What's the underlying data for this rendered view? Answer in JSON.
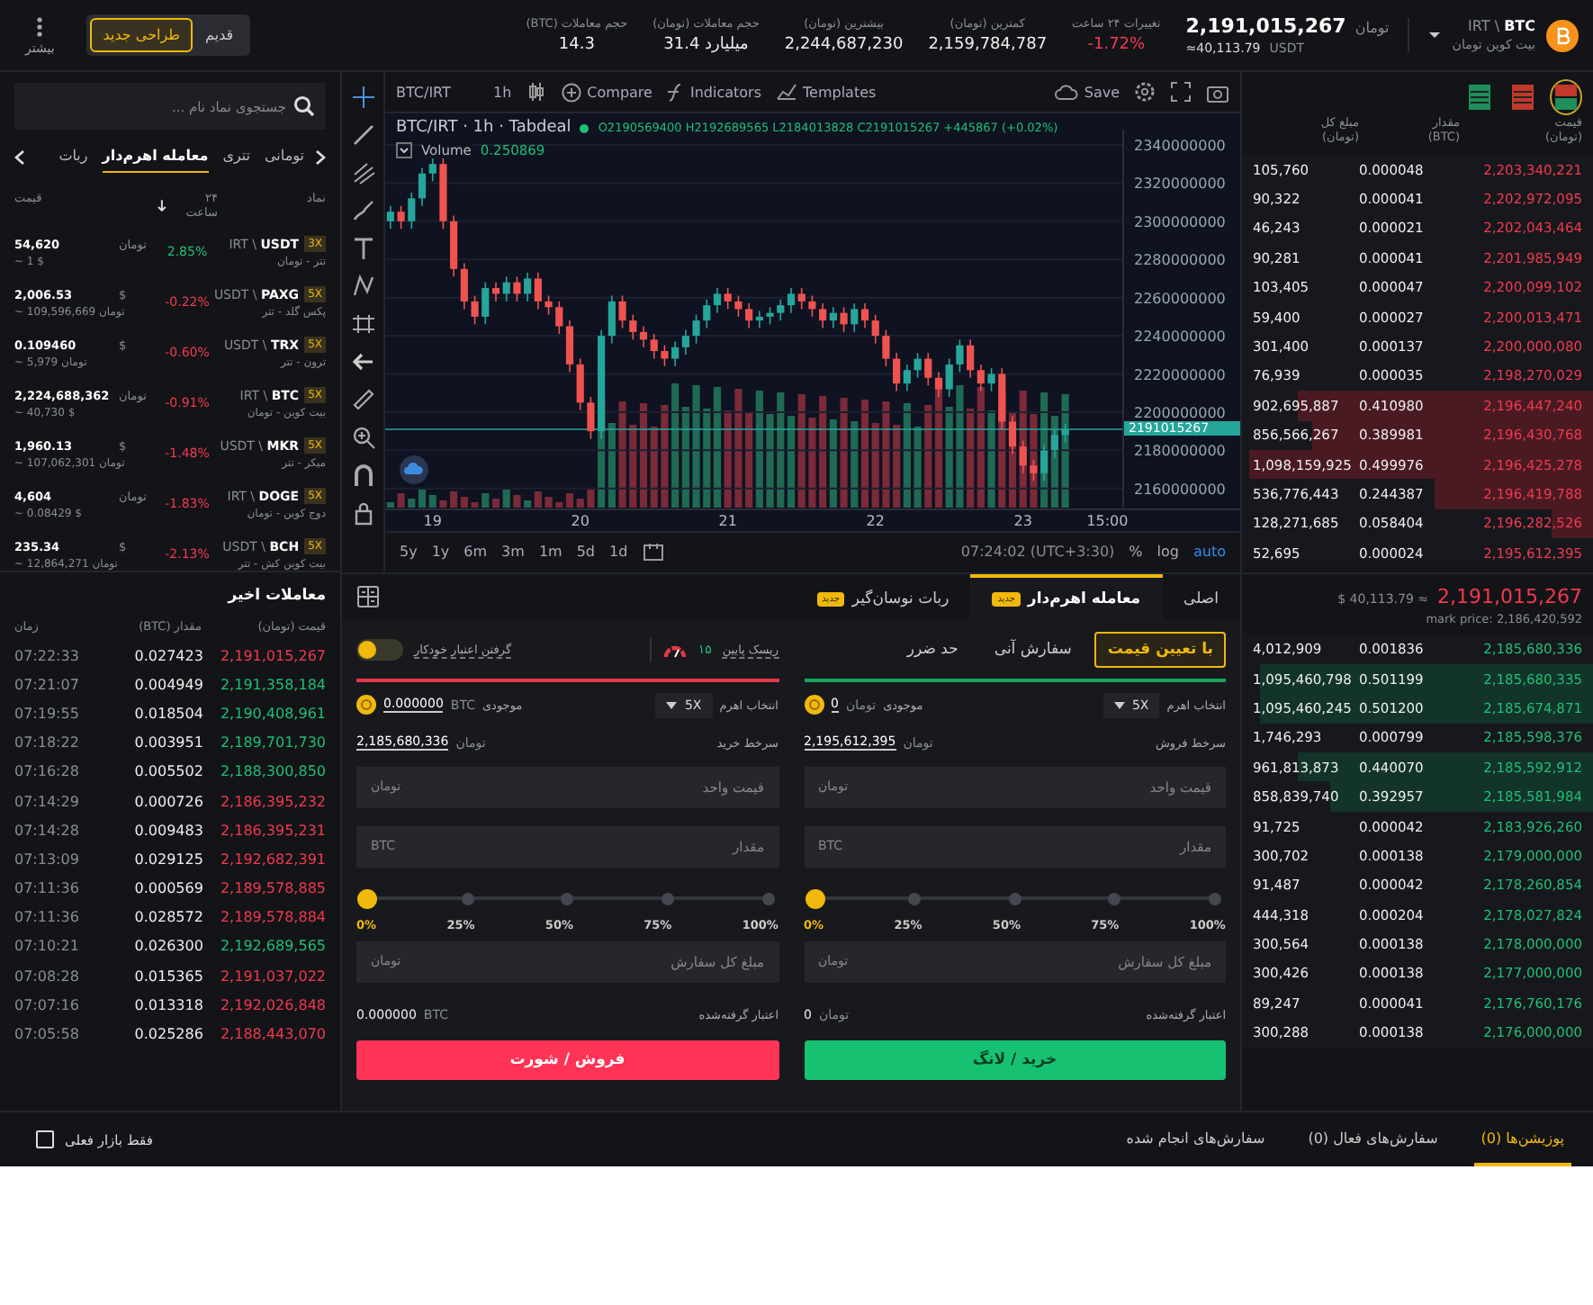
{
  "top_bar": {
    "more": {
      "label": "بیشتر"
    },
    "design_toggle": [
      {
        "label": "قدیم",
        "selected": false
      },
      {
        "label": "طراحی جدید",
        "selected": true
      }
    ],
    "stats": {
      "change_24h": {
        "label": "تغییرات ۲۴ ساعت",
        "value": "-1.72%",
        "falling": true
      },
      "low": {
        "label": "کمترین (تومان)",
        "value": "2,159,784,787",
        "falling": false
      },
      "high": {
        "label": "بیشترین (تومان)",
        "value": "2,244,687,230",
        "falling": false
      },
      "volume_toman": {
        "label": "حجم معاملات (تومان)",
        "value": "31.4 میلیارد",
        "falling": false
      },
      "volume_btc": {
        "label": "حجم معاملات (BTC)",
        "value": "14.3",
        "falling": false
      }
    },
    "price": {
      "value": "2,191,015,267",
      "unit": "تومان",
      "approx": "≈40,113.79",
      "approx_unit": "USDT"
    },
    "market": {
      "symbol": "BTC",
      "quote": "IRT \\",
      "name": "بیت کوین تومان"
    }
  },
  "markets": {
    "search": {
      "placeholder": "جستجوی نماد نام ..."
    },
    "tabs": [
      {
        "label": "تومانی",
        "selected": false
      },
      {
        "label": "تتری",
        "selected": false
      },
      {
        "label": "معامله اهرم‌دار",
        "selected": true
      },
      {
        "label": "ربات",
        "selected": false
      }
    ],
    "columns": [
      "نماد",
      "۲۴ ساعت",
      "قیمت"
    ],
    "rows": [
      {
        "symbol": "USDT",
        "quote": "IRT \\",
        "leverage": "3X",
        "name": "تتر - تومان",
        "change": "2.85%",
        "falling": false,
        "price": "54,620",
        "price_unit": "تومان",
        "approx": "~ 1 $"
      },
      {
        "symbol": "PAXG",
        "quote": "USDT \\",
        "leverage": "5X",
        "name": "پکس گلد - تتر",
        "change": "-0.22%",
        "falling": true,
        "price": "2,006.53",
        "price_unit": "$",
        "approx": "~ 109,596,669 تومان"
      },
      {
        "symbol": "TRX",
        "quote": "USDT \\",
        "leverage": "5X",
        "name": "ترون - تتر",
        "change": "-0.60%",
        "falling": true,
        "price": "0.109460",
        "price_unit": "$",
        "approx": "~ 5,979 تومان"
      },
      {
        "symbol": "BTC",
        "quote": "IRT \\",
        "leverage": "5X",
        "name": "بیت کوین - تومان",
        "change": "-0.91%",
        "falling": true,
        "price": "2,224,688,362",
        "price_unit": "تومان",
        "approx": "~ 40,730 $"
      },
      {
        "symbol": "MKR",
        "quote": "USDT \\",
        "leverage": "5X",
        "name": "میکر - تتر",
        "change": "-1.48%",
        "falling": true,
        "price": "1,960.13",
        "price_unit": "$",
        "approx": "~ 107,062,301 تومان"
      },
      {
        "symbol": "DOGE",
        "quote": "IRT \\",
        "leverage": "5X",
        "name": "دوج کوین - تومان",
        "change": "-1.83%",
        "falling": true,
        "price": "4,604",
        "price_unit": "تومان",
        "approx": "~ 0.08429 $"
      },
      {
        "symbol": "BCH",
        "quote": "USDT \\",
        "leverage": "5X",
        "name": "بیت کوین کش - تتر",
        "change": "-2.13%",
        "falling": true,
        "price": "235.34",
        "price_unit": "$",
        "approx": "~ 12,864,271 تومان"
      }
    ]
  },
  "chart": {
    "toolbar": {
      "symbol": "BTC/IRT",
      "interval": "1h",
      "compare": "Compare",
      "indicators": "Indicators",
      "templates": "Templates",
      "save": "Save"
    },
    "legend": {
      "title": "BTC/IRT · 1h · Tabdeal",
      "ohlc": "O2190569400 H2192689565 L2184013828 C2191015267 +445867 (+0.02%)",
      "volume_label": "Volume",
      "volume_value": "0.250869"
    },
    "chart_data": {
      "type": "candlestick",
      "categories": [
        null,
        null,
        null,
        null,
        "19",
        null,
        null,
        null,
        null,
        null,
        null,
        null,
        null,
        null,
        null,
        null,
        null,
        null,
        "20",
        null,
        null,
        null,
        null,
        null,
        null,
        null,
        null,
        null,
        null,
        null,
        null,
        null,
        "21",
        null,
        null,
        null,
        null,
        null,
        null,
        null,
        null,
        null,
        null,
        null,
        null,
        null,
        "22",
        null,
        null,
        null,
        null,
        null,
        null,
        null,
        null,
        null,
        null,
        null,
        null,
        null,
        "23",
        null,
        null,
        null,
        null,
        null,
        null,
        null,
        "15:00",
        null
      ],
      "ohlc": [
        [
          2300000000,
          2308000000,
          2296000000,
          2305000000
        ],
        [
          2305000000,
          2308000000,
          2296000000,
          2300000000
        ],
        [
          2300000000,
          2315000000,
          2296000000,
          2312000000
        ],
        [
          2312000000,
          2328000000,
          2308000000,
          2325000000
        ],
        [
          2325000000,
          2333000000,
          2321000000,
          2330000000
        ],
        [
          2330000000,
          2333000000,
          2296000000,
          2300000000
        ],
        [
          2300000000,
          2303000000,
          2271000000,
          2275000000
        ],
        [
          2275000000,
          2278000000,
          2254000000,
          2258000000
        ],
        [
          2258000000,
          2261000000,
          2246000000,
          2250000000
        ],
        [
          2250000000,
          2268000000,
          2246000000,
          2265000000
        ],
        [
          2265000000,
          2268000000,
          2258000000,
          2262000000
        ],
        [
          2262000000,
          2271000000,
          2258000000,
          2268000000
        ],
        [
          2268000000,
          2271000000,
          2258000000,
          2262000000
        ],
        [
          2262000000,
          2273000000,
          2258000000,
          2270000000
        ],
        [
          2270000000,
          2273000000,
          2254000000,
          2258000000
        ],
        [
          2258000000,
          2261000000,
          2251000000,
          2255000000
        ],
        [
          2255000000,
          2258000000,
          2241000000,
          2245000000
        ],
        [
          2245000000,
          2248000000,
          2221000000,
          2225000000
        ],
        [
          2225000000,
          2228000000,
          2201000000,
          2205000000
        ],
        [
          2205000000,
          2208000000,
          2186000000,
          2190000000
        ],
        [
          2190000000,
          2243000000,
          2186000000,
          2240000000
        ],
        [
          2240000000,
          2261000000,
          2236000000,
          2258000000
        ],
        [
          2258000000,
          2261000000,
          2244000000,
          2248000000
        ],
        [
          2248000000,
          2251000000,
          2238000000,
          2242000000
        ],
        [
          2242000000,
          2245000000,
          2234000000,
          2238000000
        ],
        [
          2238000000,
          2241000000,
          2228000000,
          2232000000
        ],
        [
          2232000000,
          2235000000,
          2224000000,
          2228000000
        ],
        [
          2228000000,
          2237000000,
          2224000000,
          2234000000
        ],
        [
          2234000000,
          2243000000,
          2230000000,
          2240000000
        ],
        [
          2240000000,
          2251000000,
          2236000000,
          2248000000
        ],
        [
          2248000000,
          2259000000,
          2244000000,
          2256000000
        ],
        [
          2256000000,
          2265000000,
          2252000000,
          2262000000
        ],
        [
          2262000000,
          2265000000,
          2254000000,
          2258000000
        ],
        [
          2258000000,
          2261000000,
          2250000000,
          2254000000
        ],
        [
          2254000000,
          2257000000,
          2244000000,
          2248000000
        ],
        [
          2248000000,
          2253000000,
          2244000000,
          2250000000
        ],
        [
          2250000000,
          2255000000,
          2246000000,
          2252000000
        ],
        [
          2252000000,
          2259000000,
          2248000000,
          2256000000
        ],
        [
          2256000000,
          2265000000,
          2252000000,
          2262000000
        ],
        [
          2262000000,
          2265000000,
          2254000000,
          2258000000
        ],
        [
          2258000000,
          2261000000,
          2250000000,
          2254000000
        ],
        [
          2254000000,
          2257000000,
          2244000000,
          2248000000
        ],
        [
          2248000000,
          2255000000,
          2244000000,
          2252000000
        ],
        [
          2252000000,
          2255000000,
          2242000000,
          2246000000
        ],
        [
          2246000000,
          2257000000,
          2242000000,
          2254000000
        ],
        [
          2254000000,
          2257000000,
          2244000000,
          2248000000
        ],
        [
          2248000000,
          2251000000,
          2236000000,
          2240000000
        ],
        [
          2240000000,
          2243000000,
          2224000000,
          2228000000
        ],
        [
          2228000000,
          2231000000,
          2211000000,
          2215000000
        ],
        [
          2215000000,
          2225000000,
          2211000000,
          2222000000
        ],
        [
          2222000000,
          2231000000,
          2218000000,
          2228000000
        ],
        [
          2228000000,
          2231000000,
          2214000000,
          2218000000
        ],
        [
          2218000000,
          2221000000,
          2208000000,
          2212000000
        ],
        [
          2212000000,
          2228000000,
          2208000000,
          2225000000
        ],
        [
          2225000000,
          2238000000,
          2221000000,
          2235000000
        ],
        [
          2235000000,
          2238000000,
          2218000000,
          2222000000
        ],
        [
          2222000000,
          2225000000,
          2211000000,
          2215000000
        ],
        [
          2215000000,
          2223000000,
          2211000000,
          2220000000
        ],
        [
          2220000000,
          2223000000,
          2191000000,
          2195000000
        ],
        [
          2195000000,
          2198000000,
          2178000000,
          2182000000
        ],
        [
          2182000000,
          2185000000,
          2168000000,
          2172000000
        ],
        [
          2172000000,
          2175000000,
          2164000000,
          2168000000
        ],
        [
          2168000000,
          2183000000,
          2164000000,
          2180000000
        ],
        [
          2180000000,
          2191000000,
          2176000000,
          2188000000
        ],
        [
          2188000000,
          2194000000,
          2184000000,
          2191015267
        ],
        null,
        null,
        null,
        null,
        null
      ],
      "ylim": [
        2150000000,
        2348000000
      ],
      "grid": true,
      "yticks": [
        2340000000,
        2320000000,
        2300000000,
        2280000000,
        2260000000,
        2240000000,
        2220000000,
        2200000000,
        2180000000,
        2160000000
      ]
    },
    "price_tag": "2191015267",
    "ranges": [
      "5y",
      "1y",
      "6m",
      "3m",
      "1m",
      "5d",
      "1d"
    ],
    "time": "07:24:02 (UTC+3:30)",
    "scale": [
      "%",
      "log",
      "auto"
    ]
  },
  "trade_form": {
    "tabs": [
      {
        "label": "اصلی",
        "selected": false
      },
      {
        "label": "معامله اهرم‌دار",
        "selected": true,
        "badge": "جدید"
      },
      {
        "label": "ربات نوسان‌گیر",
        "selected": false,
        "badge": "جدید"
      }
    ],
    "order_types": [
      {
        "label": "با تعیین قیمت",
        "selected": true
      },
      {
        "label": "سفارش آنی",
        "selected": false
      },
      {
        "label": "حد ضرر",
        "selected": false
      }
    ],
    "risk": {
      "label": "ریسک پایین",
      "value": "۱۵"
    },
    "auto_credit": {
      "label": "گرفتن اعتبار خودکار",
      "on": false
    },
    "sides": {
      "buy": {
        "kind": "buy",
        "leverage_label": "انتخاب اهرم",
        "leverage": "5X",
        "balance_label": "موجودی",
        "balance": "0",
        "balance_unit": "تومان",
        "best_label": "سرخط فروش",
        "best": "2,195,612,395",
        "best_unit": "تومان",
        "fields": [
          {
            "placeholder": "قیمت واحد",
            "unit": "تومان"
          },
          {
            "placeholder": "مقدار",
            "unit": "BTC"
          }
        ],
        "level": 0,
        "marks": [
          "0%",
          "25%",
          "50%",
          "75%",
          "100%"
        ],
        "total": {
          "placeholder": "مبلغ کل سفارش",
          "unit": "تومان"
        },
        "credit_label": "اعتبار گرفته‌شده",
        "credit": "0",
        "credit_unit": "تومان",
        "button": "خرید / لانگ"
      },
      "sell": {
        "kind": "sell",
        "leverage_label": "انتخاب اهرم",
        "leverage": "5X",
        "balance_label": "موجودی",
        "balance": "0.000000",
        "balance_unit": "BTC",
        "best_label": "سرخط خرید",
        "best": "2,185,680,336",
        "best_unit": "تومان",
        "fields": [
          {
            "placeholder": "قیمت واحد",
            "unit": "تومان"
          },
          {
            "placeholder": "مقدار",
            "unit": "BTC"
          }
        ],
        "level": 0,
        "marks": [
          "0%",
          "25%",
          "50%",
          "75%",
          "100%"
        ],
        "total": {
          "placeholder": "مبلغ کل سفارش",
          "unit": "تومان"
        },
        "credit_label": "اعتبار گرفته‌شده",
        "credit": "0.000000",
        "credit_unit": "BTC",
        "button": "فروش / شورت"
      }
    }
  },
  "recent_trades": {
    "title": "معاملات اخیر",
    "columns": [
      "قیمت (تومان)",
      "مقدار (BTC)",
      "زمان"
    ],
    "rows": [
      {
        "price": "2,191,015,267",
        "amount": "0.027423",
        "time": "07:22:33",
        "kind": "sell"
      },
      {
        "price": "2,191,358,184",
        "amount": "0.004949",
        "time": "07:21:07",
        "kind": "buy"
      },
      {
        "price": "2,190,408,961",
        "amount": "0.018504",
        "time": "07:19:55",
        "kind": "buy"
      },
      {
        "price": "2,189,701,730",
        "amount": "0.003951",
        "time": "07:18:22",
        "kind": "buy"
      },
      {
        "price": "2,188,300,850",
        "amount": "0.005502",
        "time": "07:16:28",
        "kind": "buy"
      },
      {
        "price": "2,186,395,232",
        "amount": "0.000726",
        "time": "07:14:29",
        "kind": "sell"
      },
      {
        "price": "2,186,395,231",
        "amount": "0.009483",
        "time": "07:14:28",
        "kind": "sell"
      },
      {
        "price": "2,192,682,391",
        "amount": "0.029125",
        "time": "07:13:09",
        "kind": "sell"
      },
      {
        "price": "2,189,578,885",
        "amount": "0.000569",
        "time": "07:11:36",
        "kind": "sell"
      },
      {
        "price": "2,189,578,884",
        "amount": "0.028572",
        "time": "07:11:36",
        "kind": "sell"
      },
      {
        "price": "2,192,689,565",
        "amount": "0.026300",
        "time": "07:10:21",
        "kind": "buy"
      },
      {
        "price": "2,191,037,022",
        "amount": "0.015365",
        "time": "07:08:28",
        "kind": "sell"
      },
      {
        "price": "2,192,026,848",
        "amount": "0.013318",
        "time": "07:07:16",
        "kind": "sell"
      },
      {
        "price": "2,188,443,070",
        "amount": "0.025286",
        "time": "07:05:58",
        "kind": "sell"
      }
    ]
  },
  "order_book": {
    "views": [
      {
        "kind": "both",
        "selected": true
      },
      {
        "kind": "asks",
        "selected": false
      },
      {
        "kind": "bids",
        "selected": false
      }
    ],
    "columns": [
      {
        "label": "قیمت",
        "unit": "(تومان)"
      },
      {
        "label": "مقدار",
        "unit": "(BTC)"
      },
      {
        "label": "مبلغ کل",
        "unit": "(تومان)"
      }
    ],
    "asks": [
      {
        "price": "2,203,340,221",
        "amount": "0.000048",
        "total": "105,760"
      },
      {
        "price": "2,202,972,095",
        "amount": "0.000041",
        "total": "90,322"
      },
      {
        "price": "2,202,043,464",
        "amount": "0.000021",
        "total": "46,243"
      },
      {
        "price": "2,201,985,949",
        "amount": "0.000041",
        "total": "90,281"
      },
      {
        "price": "2,200,099,102",
        "amount": "0.000047",
        "total": "103,405"
      },
      {
        "price": "2,200,013,471",
        "amount": "0.000027",
        "total": "59,400"
      },
      {
        "price": "2,200,000,080",
        "amount": "0.000137",
        "total": "301,400"
      },
      {
        "price": "2,198,270,029",
        "amount": "0.000035",
        "total": "76,939"
      },
      {
        "price": "2,196,447,240",
        "amount": "0.410980",
        "total": "902,695,887",
        "level": 0.84
      },
      {
        "price": "2,196,430,768",
        "amount": "0.389981",
        "total": "856,566,267",
        "level": 0.8
      },
      {
        "price": "2,196,425,278",
        "amount": "0.499976",
        "total": "1,098,159,925",
        "level": 0.98
      },
      {
        "price": "2,196,419,788",
        "amount": "0.244387",
        "total": "536,776,443",
        "level": 0.45
      },
      {
        "price": "2,196,282,526",
        "amount": "0.058404",
        "total": "128,271,685",
        "level": 0.12
      },
      {
        "price": "2,195,612,395",
        "amount": "0.000024",
        "total": "52,695"
      }
    ],
    "last_price": "2,191,015,267",
    "last_approx": "$ 40,113.79 ≈",
    "mark_price": "mark price: 2,186,420,592",
    "bids": [
      {
        "price": "2,185,680,336",
        "amount": "0.001836",
        "total": "4,012,909"
      },
      {
        "price": "2,185,680,335",
        "amount": "0.501199",
        "total": "1,095,460,798",
        "level": 0.95
      },
      {
        "price": "2,185,674,871",
        "amount": "0.501200",
        "total": "1,095,460,245",
        "level": 0.95
      },
      {
        "price": "2,185,598,376",
        "amount": "0.000799",
        "total": "1,746,293"
      },
      {
        "price": "2,185,592,912",
        "amount": "0.440070",
        "total": "961,813,873",
        "level": 0.84
      },
      {
        "price": "2,185,581,984",
        "amount": "0.392957",
        "total": "858,839,740",
        "level": 0.75
      },
      {
        "price": "2,183,926,260",
        "amount": "0.000042",
        "total": "91,725"
      },
      {
        "price": "2,179,000,000",
        "amount": "0.000138",
        "total": "300,702"
      },
      {
        "price": "2,178,260,854",
        "amount": "0.000042",
        "total": "91,487"
      },
      {
        "price": "2,178,027,824",
        "amount": "0.000204",
        "total": "444,318"
      },
      {
        "price": "2,178,000,000",
        "amount": "0.000138",
        "total": "300,564"
      },
      {
        "price": "2,177,000,000",
        "amount": "0.000138",
        "total": "300,426"
      },
      {
        "price": "2,176,760,176",
        "amount": "0.000041",
        "total": "89,247"
      },
      {
        "price": "2,176,000,000",
        "amount": "0.000138",
        "total": "300,288"
      }
    ]
  },
  "bottom_bar": {
    "current_market_only": {
      "label": "فقط بازار فعلی",
      "checked": false
    },
    "tabs": [
      {
        "label": "پوزیشن‌ها (0)",
        "selected": true
      },
      {
        "label": "سفارش‌های فعال (0)",
        "selected": false
      },
      {
        "label": "سفارش‌های انجام شده",
        "selected": false
      }
    ]
  }
}
